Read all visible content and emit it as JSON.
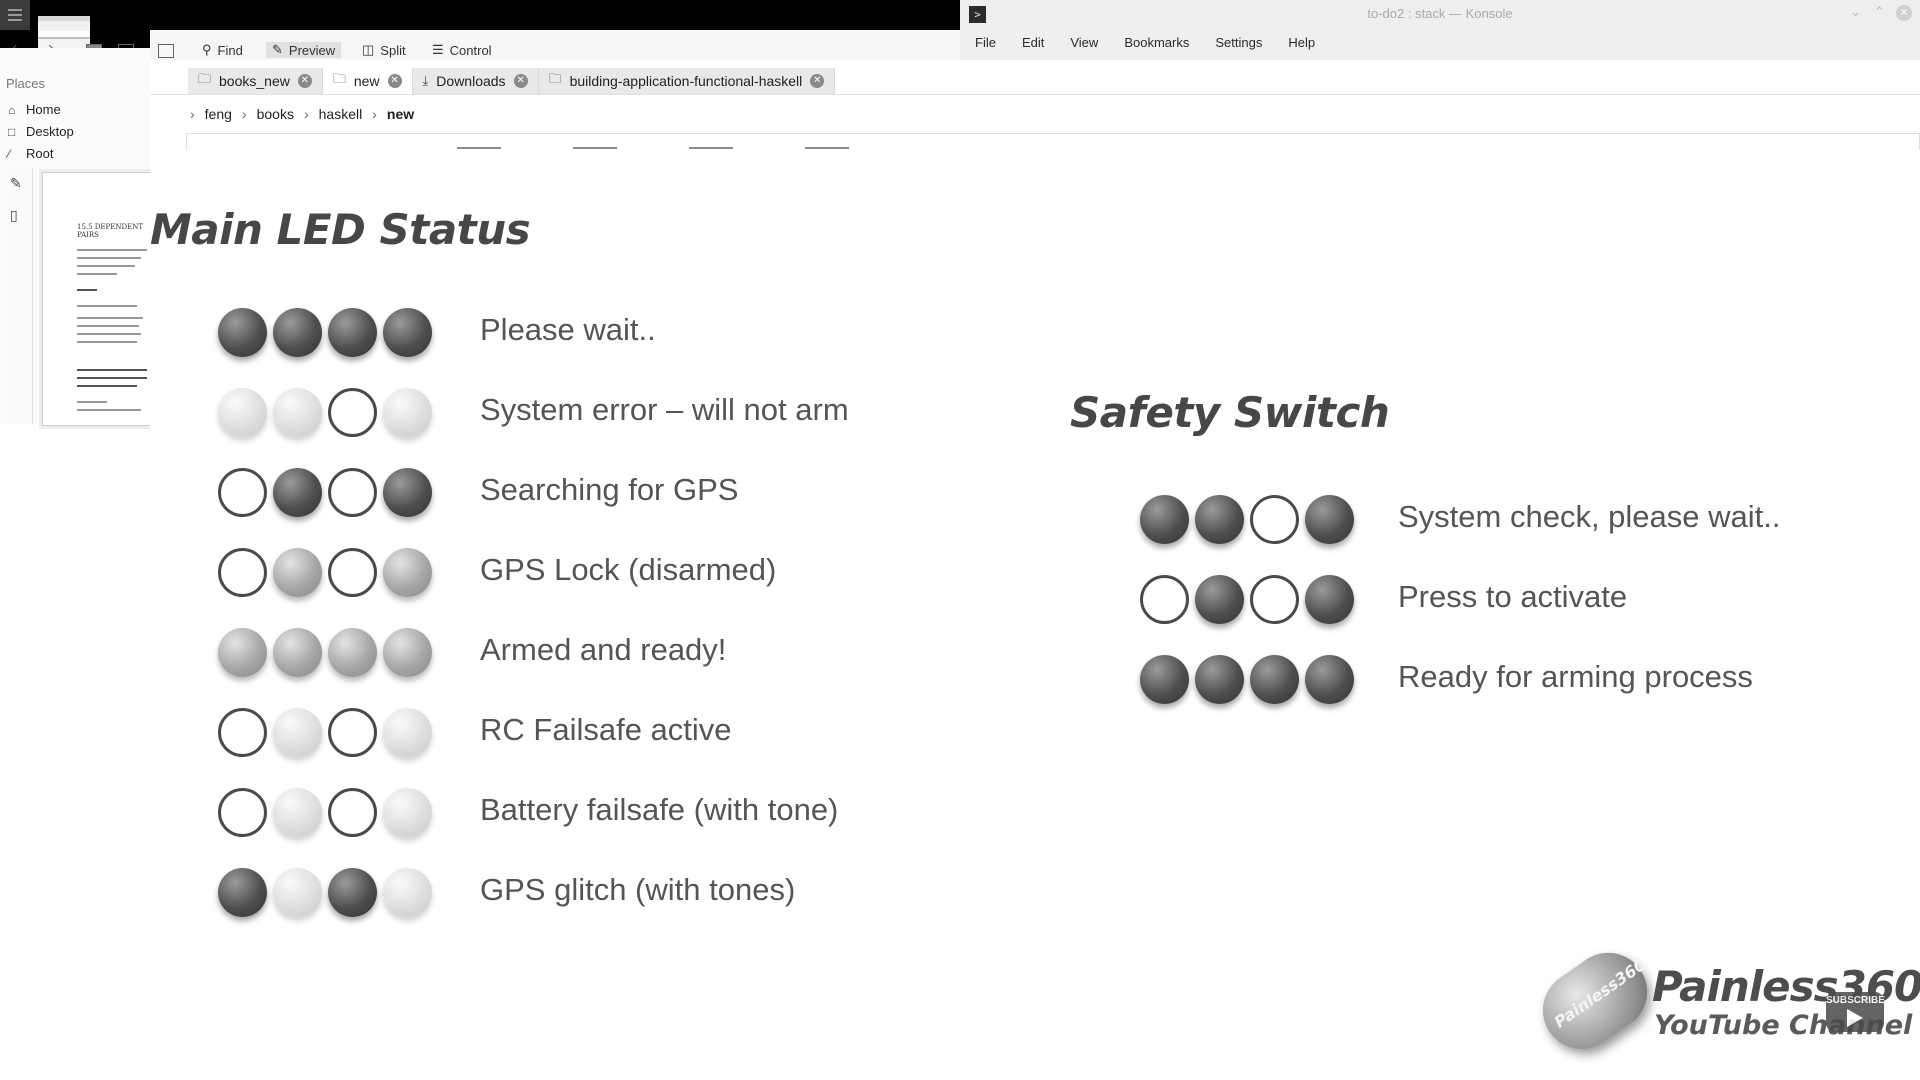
{
  "konsole": {
    "title": "to-do2 : stack — Konsole",
    "menu": [
      "File",
      "Edit",
      "View",
      "Bookmarks",
      "Settings",
      "Help"
    ]
  },
  "file_manager": {
    "toolbar": {
      "find": "Find",
      "preview": "Preview",
      "split": "Split",
      "control": "Control"
    },
    "places": {
      "header": "Places",
      "items": [
        "Home",
        "Desktop",
        "Root"
      ]
    },
    "tabs": [
      {
        "label": "books_new",
        "icon": "folder-icon"
      },
      {
        "label": "new",
        "icon": "folder-icon",
        "active": true
      },
      {
        "label": "Downloads",
        "icon": "download-icon"
      },
      {
        "label": "building-application-functional-haskell",
        "icon": "folder-icon"
      }
    ],
    "breadcrumb": [
      "feng",
      "books",
      "haskell",
      "new"
    ],
    "preview_doc": {
      "header": "15.5 DEPENDENT PAIRS"
    }
  },
  "slide": {
    "main_title": "Main LED Status",
    "main_rows": [
      {
        "leds": [
          "dark",
          "dark",
          "dark",
          "dark"
        ],
        "label": "Please wait.."
      },
      {
        "leds": [
          "light",
          "light",
          "off",
          "light"
        ],
        "label": "System error – will not arm"
      },
      {
        "leds": [
          "off",
          "dark",
          "off",
          "dark"
        ],
        "label": "Searching for GPS"
      },
      {
        "leds": [
          "off",
          "mid",
          "off",
          "mid"
        ],
        "label": "GPS Lock (disarmed)"
      },
      {
        "leds": [
          "mid",
          "mid",
          "mid",
          "mid"
        ],
        "label": "Armed and ready!"
      },
      {
        "leds": [
          "off",
          "light",
          "off",
          "light"
        ],
        "label": "RC Failsafe active"
      },
      {
        "leds": [
          "off",
          "light",
          "off",
          "light"
        ],
        "label": "Battery failsafe (with tone)"
      },
      {
        "leds": [
          "dark",
          "light",
          "dark",
          "light"
        ],
        "label": "GPS glitch (with tones)"
      }
    ],
    "safety_title": "Safety Switch",
    "safety_rows": [
      {
        "leds": [
          "dark",
          "dark",
          "off",
          "dark"
        ],
        "label": "System check, please wait.."
      },
      {
        "leds": [
          "off",
          "dark",
          "off",
          "dark"
        ],
        "label": "Press to activate"
      },
      {
        "leds": [
          "dark",
          "dark",
          "dark",
          "dark"
        ],
        "label": "Ready for arming process"
      }
    ],
    "brand": {
      "name": "Painless360",
      "subtitle": "YouTube Channel",
      "badge": "Painless360",
      "subscribe": "SUBSCRIBE"
    }
  },
  "colors": {
    "led_dark": "#4e4e4e",
    "led_mid": "#a6a6a6",
    "led_light": "#dedede",
    "led_off_ring": "#4a4a4a",
    "text_gray": "#555555"
  }
}
